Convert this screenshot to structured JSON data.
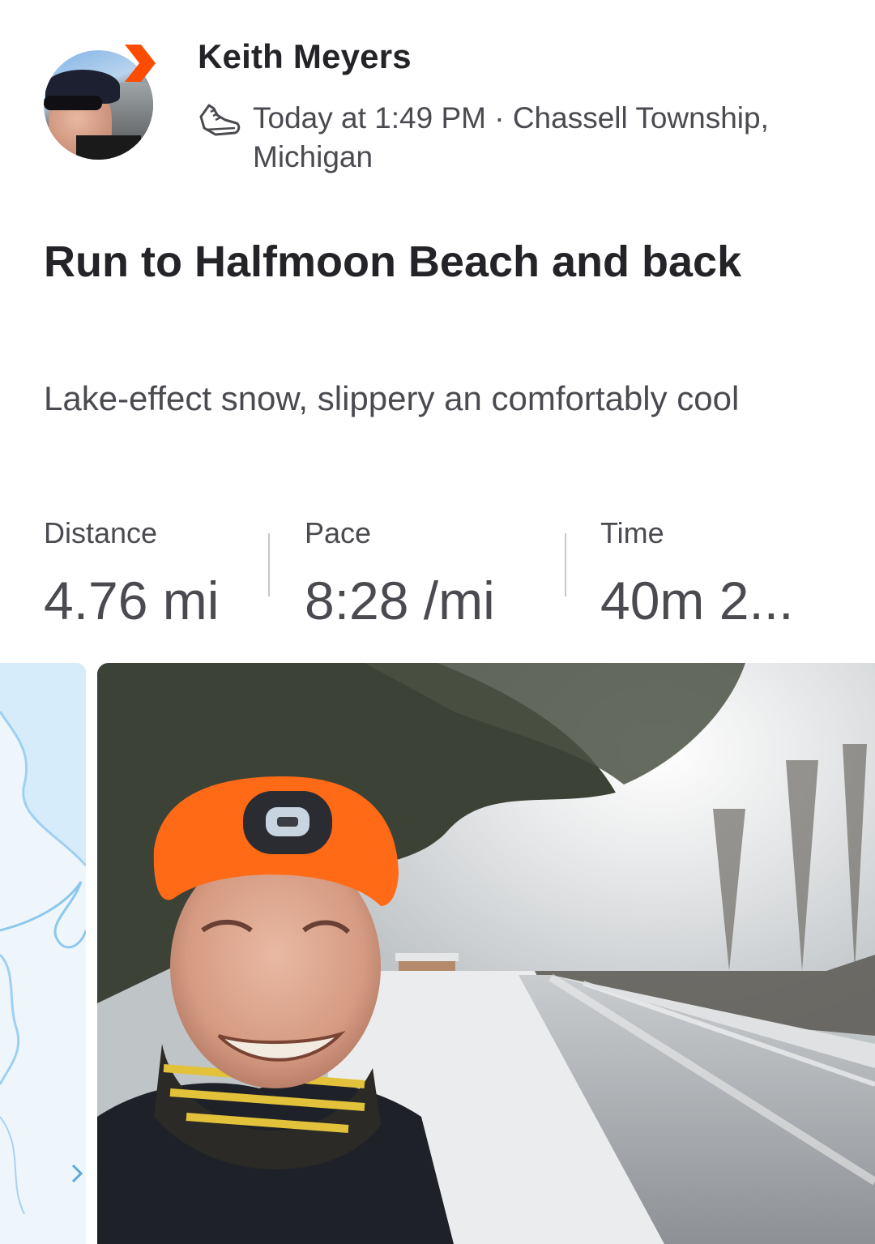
{
  "header": {
    "user_name": "Keith Meyers",
    "activity_icon": "running-shoe-icon",
    "meta": "Today at 1:49 PM · Chassell Township, Michigan"
  },
  "activity": {
    "title": "Run to Halfmoon Beach and back",
    "description": "Lake-effect snow, slippery an comfortably cool"
  },
  "stats": [
    {
      "label": "Distance",
      "value": "4.76 mi"
    },
    {
      "label": "Pace",
      "value": "8:28 /mi"
    },
    {
      "label": "Time",
      "value": "40m 2..."
    }
  ],
  "colors": {
    "brand_orange": "#fc4c02",
    "text_primary": "#242428",
    "text_secondary": "#4a4a50",
    "map_water": "#d6ecfb"
  }
}
